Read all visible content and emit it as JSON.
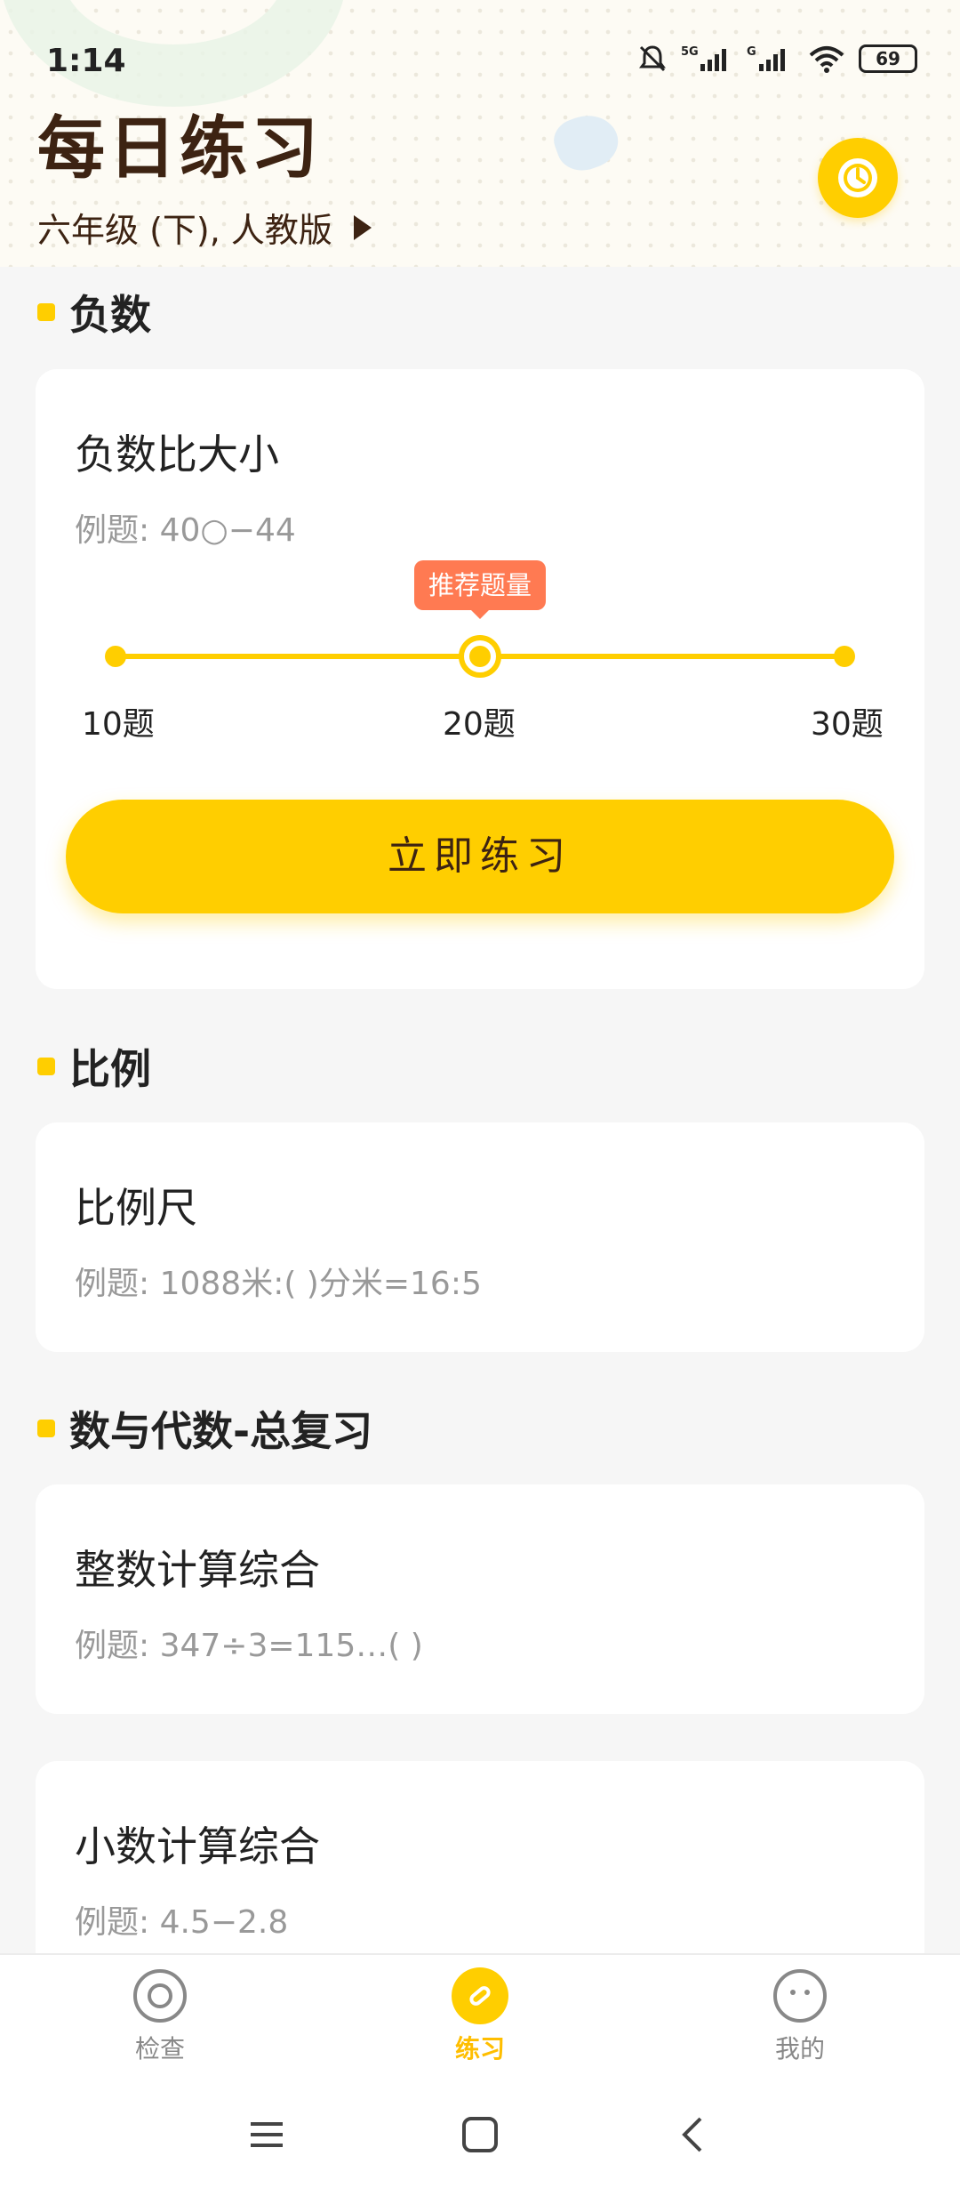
{
  "status_bar": {
    "time": "1:14",
    "battery": "69"
  },
  "header": {
    "title": "每日练习",
    "grade": "六年级 (下), 人教版"
  },
  "sections": [
    {
      "title": "负数",
      "cards": [
        {
          "title": "负数比大小",
          "example": "例题: 40○−44",
          "slider": {
            "tip": "推荐题量",
            "labels": [
              "10题",
              "20题",
              "30题"
            ],
            "selected": "20题"
          },
          "button": "立即练习"
        }
      ]
    },
    {
      "title": "比例",
      "cards": [
        {
          "title": "比例尺",
          "example": "例题: 1088米:(   )分米=16:5"
        }
      ]
    },
    {
      "title": "数与代数-总复习",
      "cards": [
        {
          "title": "整数计算综合",
          "example": "例题: 347÷3=115…(   )"
        },
        {
          "title": "小数计算综合",
          "example": "例题: 4.5−2.8"
        }
      ]
    }
  ],
  "bottom_nav": [
    {
      "label": "检查",
      "icon": "check-icon",
      "active": false
    },
    {
      "label": "练习",
      "icon": "pencil-icon",
      "active": true
    },
    {
      "label": "我的",
      "icon": "face-icon",
      "active": false
    }
  ],
  "colors": {
    "accent": "#ffce00",
    "title_brown": "#3d2312",
    "tip_orange": "#ff7a52"
  }
}
